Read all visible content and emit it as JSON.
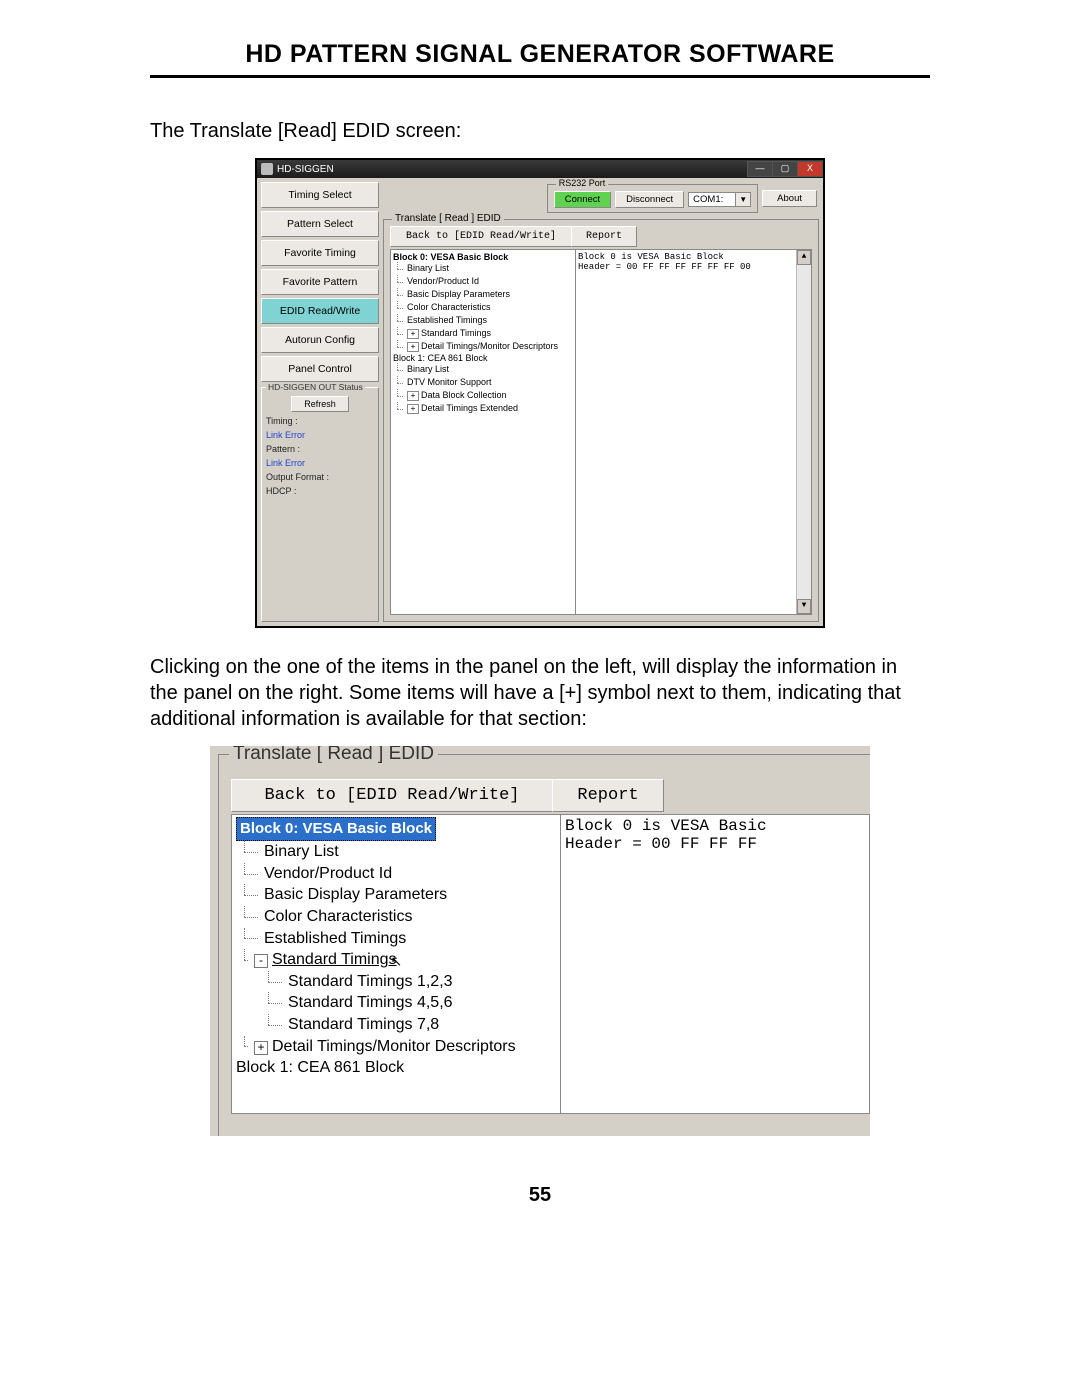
{
  "page": {
    "title": "HD PATTERN SIGNAL GENERATOR SOFTWARE",
    "intro": "The Translate [Read] EDID screen:",
    "body": "Clicking on the one of the items in the panel on the left, will display the information in the panel on the right.  Some items will have a [+] symbol next to them, indicating that additional information is available for that section:",
    "page_number": "55"
  },
  "app": {
    "window_title": "HD-SIGGEN",
    "winbtn_min": "—",
    "winbtn_max": "▢",
    "winbtn_close": "X",
    "sidebar": {
      "items": [
        "Timing Select",
        "Pattern Select",
        "Favorite Timing",
        "Favorite Pattern",
        "EDID Read/Write",
        "Autorun Config",
        "Panel Control"
      ],
      "active_index": 4
    },
    "out_status": {
      "title": "HD-SIGGEN OUT Status",
      "refresh": "Refresh",
      "lines": [
        {
          "text": "Timing :",
          "err": false
        },
        {
          "text": "Link Error",
          "err": true
        },
        {
          "text": "Pattern :",
          "err": false
        },
        {
          "text": "Link Error",
          "err": true
        },
        {
          "text": "Output Format :",
          "err": false
        },
        {
          "text": "",
          "err": false
        },
        {
          "text": "HDCP :",
          "err": false
        }
      ]
    },
    "topbar": {
      "rs232_title": "RS232 Port",
      "connect": "Connect",
      "disconnect": "Disconnect",
      "com_selected": "COM1:",
      "combo_arrow": "▼",
      "about": "About"
    },
    "edid": {
      "group_title": "Translate [ Read ] EDID",
      "back_btn": "Back to [EDID Read/Write]",
      "report_btn": "Report",
      "scroll_up": "▲",
      "scroll_down": "▼",
      "tree": {
        "block0_label": "Block 0: VESA Basic Block",
        "block0_children": [
          "Binary List",
          "Vendor/Product Id",
          "Basic Display Parameters",
          "Color Characteristics",
          "Established Timings"
        ],
        "block0_exp": [
          {
            "exp": "+",
            "label": "Standard Timings"
          },
          {
            "exp": "+",
            "label": "Detail Timings/Monitor Descriptors"
          }
        ],
        "block1_label": "Block 1: CEA 861 Block",
        "block1_children": [
          "Binary List",
          "DTV Monitor Support"
        ],
        "block1_exp": [
          {
            "exp": "+",
            "label": "Data Block Collection"
          },
          {
            "exp": "+",
            "label": "Detail Timings Extended"
          }
        ]
      },
      "info": {
        "line1": "Block 0 is VESA Basic Block",
        "line2": "Header = 00 FF FF FF FF FF FF 00"
      }
    }
  },
  "zoom": {
    "group_title": "Translate [ Read ] EDID",
    "back_btn": "Back to [EDID Read/Write]",
    "report_btn": "Report",
    "tree": {
      "root": "Block 0: VESA Basic Block",
      "children": [
        "Binary List",
        "Vendor/Product Id",
        "Basic Display Parameters",
        "Color Characteristics",
        "Established Timings"
      ],
      "expanded_exp": "-",
      "expanded_label": "Standard Timings",
      "cursor": "↖",
      "expanded_children": [
        "Standard Timings 1,2,3",
        "Standard Timings 4,5,6",
        "Standard Timings 7,8"
      ],
      "collapsed_exp": "+",
      "collapsed_label": "Detail Timings/Monitor Descriptors",
      "block1": "Block 1: CEA 861 Block"
    },
    "info": {
      "line1": "Block 0 is VESA Basic",
      "line2": "Header = 00 FF FF FF"
    }
  }
}
